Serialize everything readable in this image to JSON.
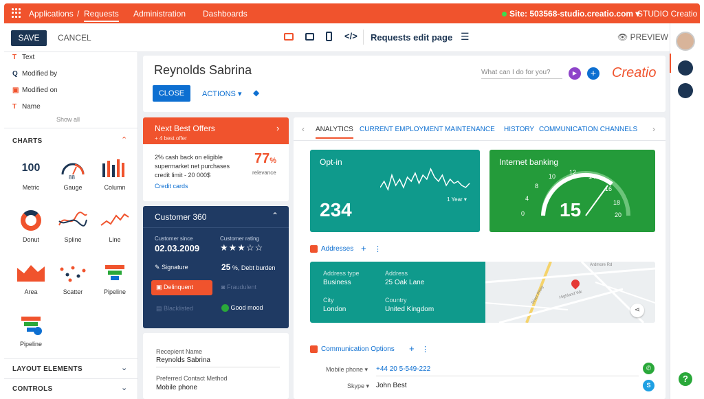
{
  "topbar": {
    "breadcrumb_root": "Applications",
    "breadcrumb_sep": "/",
    "breadcrumb_current": "Requests",
    "nav_administration": "Administration",
    "nav_dashboards": "Dashboards",
    "site": "Site: 503568-studio.creatio.com",
    "brand": "STUDIO Creatio"
  },
  "toolbar": {
    "save": "SAVE",
    "cancel": "CANCEL",
    "page_title": "Requests edit page",
    "preview": "PREVIEW"
  },
  "left_panel": {
    "fields": [
      {
        "icon": "T",
        "label": "Text"
      },
      {
        "icon": "Q",
        "label": "Modified by"
      },
      {
        "icon": "D",
        "label": "Modified on"
      },
      {
        "icon": "T",
        "label": "Name"
      }
    ],
    "show_all": "Show all",
    "charts_header": "CHARTS",
    "charts": [
      "Metric",
      "Gauge",
      "Column",
      "Donut",
      "Spline",
      "Line",
      "Area",
      "Scatter",
      "Pipeline",
      "Pipeline"
    ],
    "metric_value": "100",
    "gauge_value": "88",
    "layout_elements": "LAYOUT ELEMENTS",
    "controls": "CONTROLS"
  },
  "header_card": {
    "name": "Reynolds Sabrina",
    "close": "CLOSE",
    "actions": "ACTIONS",
    "search_placeholder": "What can I do for you?",
    "logo": "Creatio"
  },
  "nbo": {
    "title": "Next Best Offers",
    "subtitle": "+ 4 best offer",
    "offer_text_1": "2% cash back on eligible",
    "offer_text_2": "supermarket net purchases",
    "offer_text_3": "credit limit - 20 000$",
    "percent": "77",
    "percent_sign": "%",
    "relevance": "relevance",
    "link": "Credit cards"
  },
  "c360": {
    "title": "Customer 360",
    "since_label": "Customer since",
    "since_value": "02.03.2009",
    "rating_label": "Customer rating",
    "rating": 3,
    "rating_max": 5,
    "signature": "Signature",
    "debt_value": "25",
    "debt_label": "%, Debt burden",
    "delinquent": "Delinquent",
    "fraudulent": "Fraudulent",
    "blacklisted": "Blacklisted",
    "good_mood": "Good mood"
  },
  "contact": {
    "recipient_label": "Recepient Name",
    "recipient_value": "Reynolds Sabrina",
    "method_label": "Preferred Contact Method",
    "method_value": "Mobile phone"
  },
  "tabs": [
    "ANALYTICS",
    "CURRENT EMPLOYMENT",
    "MAINTENANCE",
    "HISTORY",
    "COMMUNICATION CHANNELS"
  ],
  "optin": {
    "title": "Opt-in",
    "value": "234",
    "period": "1 Year",
    "spark": [
      3,
      6,
      2,
      9,
      4,
      7,
      3,
      8,
      6,
      10,
      5,
      9,
      7,
      12,
      8,
      6,
      9,
      4,
      7,
      5,
      6,
      4,
      3,
      5
    ]
  },
  "internet_banking": {
    "title": "Internet banking",
    "value": "15",
    "ticks": [
      "0",
      "4",
      "8",
      "10",
      "12",
      "14",
      "16",
      "18",
      "20"
    ],
    "gauge_value": 15,
    "gauge_max": 20
  },
  "addresses": {
    "title": "Addresses",
    "type_label": "Address type",
    "type_value": "Business",
    "address_label": "Address",
    "address_value": "25 Oak Lane",
    "city_label": "City",
    "city_value": "London",
    "country_label": "Country",
    "country_value": "United Kingdom",
    "map_road_1": "Highland Wk",
    "map_road_2": "Ardmore Rd",
    "map_road_3": "River Pkwy"
  },
  "comm": {
    "title": "Communication Options",
    "mobile_label": "Mobile phone",
    "mobile_value": "+44 20 5-549-222",
    "skype_label": "Skype",
    "skype_value": "John Best"
  },
  "colors": {
    "accent": "#f0532d",
    "navy": "#1c3553",
    "teal": "#0d9a8e",
    "green": "#2aa83a",
    "link": "#0d6fd1"
  }
}
